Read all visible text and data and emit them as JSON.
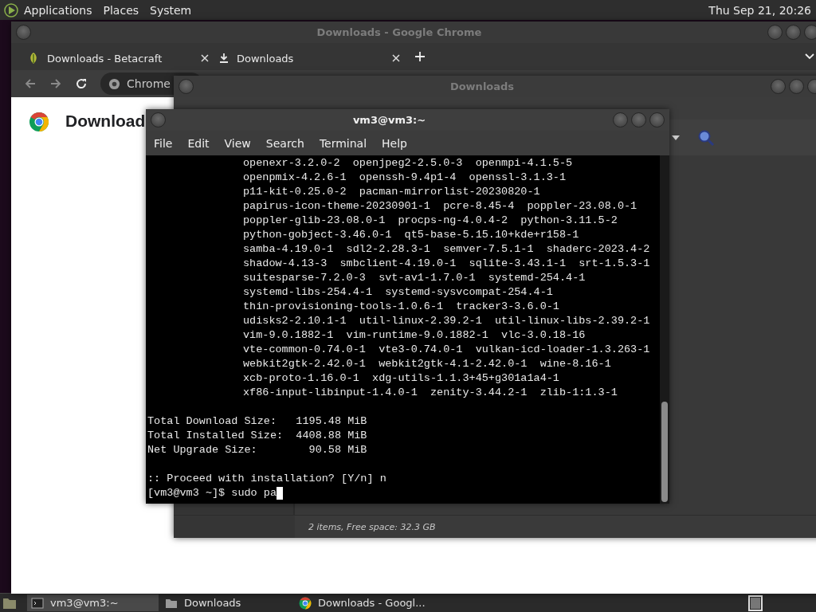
{
  "top_panel": {
    "menus": [
      "Applications",
      "Places",
      "System"
    ],
    "clock": "Thu Sep 21, 20:26"
  },
  "chrome": {
    "title": "Downloads - Google Chrome",
    "tabs": [
      {
        "label": "Downloads - Betacraft",
        "kind": "site"
      },
      {
        "label": "Downloads",
        "kind": "download"
      }
    ],
    "omnibox": "Chrome",
    "heading": "Download"
  },
  "files": {
    "title": "Downloads",
    "status": "2 items, Free space: 32.3 GB"
  },
  "terminal": {
    "title": "vm3@vm3:~",
    "menus": [
      "File",
      "Edit",
      "View",
      "Search",
      "Terminal",
      "Help"
    ],
    "lines": [
      {
        "kind": "package",
        "text": "openexr-3.2.0-2  openjpeg2-2.5.0-3  openmpi-4.1.5-5"
      },
      {
        "kind": "package",
        "text": "openpmix-4.2.6-1  openssh-9.4p1-4  openssl-3.1.3-1"
      },
      {
        "kind": "package",
        "text": "p11-kit-0.25.0-2  pacman-mirrorlist-20230820-1"
      },
      {
        "kind": "package",
        "text": "papirus-icon-theme-20230901-1  pcre-8.45-4  poppler-23.08.0-1"
      },
      {
        "kind": "package",
        "text": "poppler-glib-23.08.0-1  procps-ng-4.0.4-2  python-3.11.5-2"
      },
      {
        "kind": "package",
        "text": "python-gobject-3.46.0-1  qt5-base-5.15.10+kde+r158-1"
      },
      {
        "kind": "package",
        "text": "samba-4.19.0-1  sdl2-2.28.3-1  semver-7.5.1-1  shaderc-2023.4-2"
      },
      {
        "kind": "package",
        "text": "shadow-4.13-3  smbclient-4.19.0-1  sqlite-3.43.1-1  srt-1.5.3-1"
      },
      {
        "kind": "package",
        "text": "suitesparse-7.2.0-3  svt-av1-1.7.0-1  systemd-254.4-1"
      },
      {
        "kind": "package",
        "text": "systemd-libs-254.4-1  systemd-sysvcompat-254.4-1"
      },
      {
        "kind": "package",
        "text": "thin-provisioning-tools-1.0.6-1  tracker3-3.6.0-1"
      },
      {
        "kind": "package",
        "text": "udisks2-2.10.1-1  util-linux-2.39.2-1  util-linux-libs-2.39.2-1"
      },
      {
        "kind": "package",
        "text": "vim-9.0.1882-1  vim-runtime-9.0.1882-1  vlc-3.0.18-16"
      },
      {
        "kind": "package",
        "text": "vte-common-0.74.0-1  vte3-0.74.0-1  vulkan-icd-loader-1.3.263-1"
      },
      {
        "kind": "package",
        "text": "webkit2gtk-2.42.0-1  webkit2gtk-4.1-2.42.0-1  wine-8.16-1"
      },
      {
        "kind": "package",
        "text": "xcb-proto-1.16.0-1  xdg-utils-1.1.3+45+g301a1a4-1"
      },
      {
        "kind": "package",
        "text": "xf86-input-libinput-1.4.0-1  zenity-3.44.2-1  zlib-1:1.3-1"
      },
      {
        "kind": "blank"
      },
      {
        "kind": "text",
        "text": "Total Download Size:   1195.48 MiB"
      },
      {
        "kind": "text",
        "text": "Total Installed Size:  4408.88 MiB"
      },
      {
        "kind": "text",
        "text": "Net Upgrade Size:        90.58 MiB"
      },
      {
        "kind": "blank"
      },
      {
        "kind": "text",
        "text": ":: Proceed with installation? [Y/n] n"
      },
      {
        "kind": "prompt",
        "text": "[vm3@vm3 ~]$ sudo pa"
      }
    ]
  },
  "taskbar": {
    "tasks": [
      {
        "label": "vm3@vm3:~",
        "selected": true,
        "kind": "terminal"
      },
      {
        "label": "Downloads",
        "selected": false,
        "kind": "folder"
      },
      {
        "label": "Downloads - Googl...",
        "selected": false,
        "kind": "browser"
      }
    ]
  }
}
